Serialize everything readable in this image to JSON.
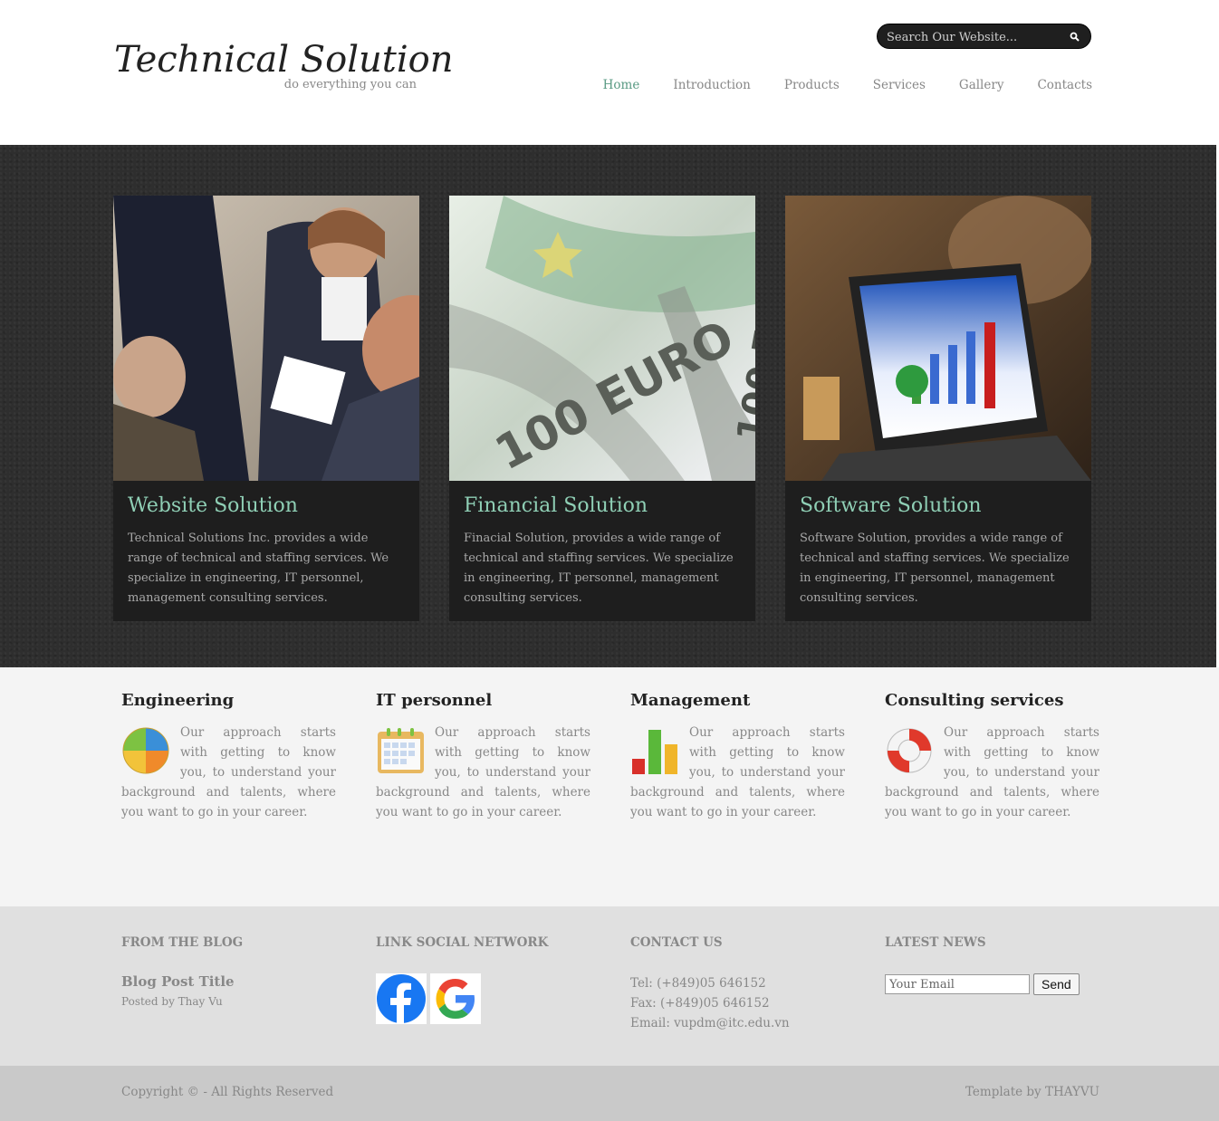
{
  "header": {
    "logo_title": "Technical Solution",
    "logo_tagline": "do everything you can",
    "search_placeholder": "Search Our Website...",
    "nav": [
      "Home",
      "Introduction",
      "Products",
      "Services",
      "Gallery",
      "Contacts"
    ],
    "active_nav": "Home"
  },
  "cards": [
    {
      "title": "Website Solution",
      "text": "Technical Solutions Inc. provides a wide range of technical and staffing services. We specialize in engineering, IT personnel, management consulting services."
    },
    {
      "title": "Financial Solution",
      "text": "Finacial Solution, provides a wide range of technical and staffing services. We specialize in engineering, IT personnel, management consulting services."
    },
    {
      "title": "Software Solution",
      "text": "Software Solution, provides a wide range of technical and staffing services. We specialize in engineering, IT personnel, management consulting services."
    }
  ],
  "features": [
    {
      "title": "Engineering",
      "text": "Our approach starts with getting to know you, to understand your background and talents, where you want to go in your career.",
      "icon": "pie-chart-icon"
    },
    {
      "title": "IT personnel",
      "text": "Our approach starts with getting to know you, to understand your background and talents, where you want to go in your career.",
      "icon": "calendar-icon"
    },
    {
      "title": "Management",
      "text": "Our approach starts with getting to know you, to understand your background and talents, where you want to go in your career.",
      "icon": "bar-chart-icon"
    },
    {
      "title": "Consulting services",
      "text": "Our approach starts with getting to know you, to understand your background and talents, where you want to go in your career.",
      "icon": "lifebuoy-icon"
    }
  ],
  "footer": {
    "blog_heading": "FROM THE BLOG",
    "blog_post_title": "Blog Post Title",
    "blog_post_meta": "Posted by Thay Vu",
    "social_heading": "LINK SOCIAL NETWORK",
    "contact_heading": "CONTACT US",
    "contact_tel": "Tel: (+849)05 646152",
    "contact_fax": "Fax: (+849)05 646152",
    "contact_email": "Email: vupdm@itc.edu.vn",
    "news_heading": "LATEST NEWS",
    "email_placeholder": "Your Email",
    "send_label": "Send",
    "copyright": "Copyright © - All Rights Reserved",
    "credit": "Template by THAYVU"
  },
  "colors": {
    "accent": "#5a9b84",
    "card_title": "#8fcfb5"
  }
}
